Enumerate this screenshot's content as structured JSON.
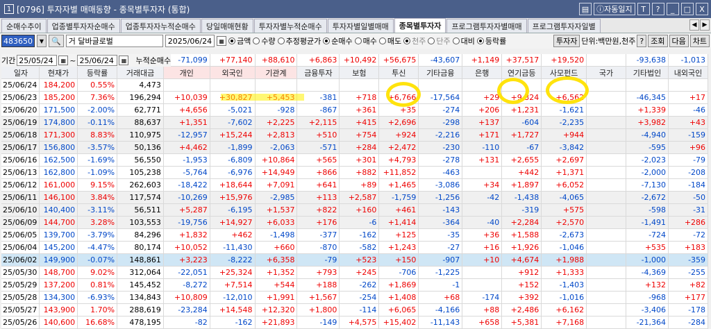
{
  "window": {
    "number": "1",
    "title": "[0796] 투자자별 매매동향 - 종목별투자자 (통합)",
    "auto_label": "자동일지",
    "buttons": [
      "T",
      "?",
      "_",
      "□",
      "X"
    ]
  },
  "tabs": [
    "순매수추이",
    "업종별투자자순매수",
    "업종투자자누적순매수",
    "당일매매현황",
    "투자자별누적순매수",
    "투자자별일별매매",
    "종목별투자자",
    "프로그램투자자별매매",
    "프로그램투자자일별"
  ],
  "active_tab": "종목별투자자",
  "controls": {
    "code": "483650",
    "stock_type": "거",
    "stock_name": "달바글로벌",
    "date": "2025/06/24",
    "radio_amount": [
      "금액",
      "수량",
      "추정평균가"
    ],
    "radio_trade": [
      "순매수",
      "매수",
      "매도"
    ],
    "radio_unit": [
      "천주",
      "단주"
    ],
    "radio_compare": [
      "대비",
      "등락률"
    ],
    "investor_btn": "투자자",
    "unit_label": "단위:백만원,천주",
    "help": "?",
    "search": "조회",
    "next": "다음",
    "chart": "차트"
  },
  "period": {
    "label": "기간",
    "from": "25/05/24",
    "to": "25/06/24",
    "cumulative_label": "누적순매수"
  },
  "summary": [
    "",
    "",
    "",
    "",
    "-71,099",
    "+77,140",
    "+88,610",
    "+6,863",
    "+10,492",
    "+56,675",
    "-43,607",
    "+1,149",
    "+37,517",
    "+19,520",
    "",
    "-93,638",
    "-1,013"
  ],
  "summary_colors": [
    "",
    "",
    "",
    "",
    "b",
    "r",
    "r",
    "r",
    "r",
    "r",
    "b",
    "r",
    "r",
    "r",
    "",
    "b",
    "b"
  ],
  "columns": [
    "일자",
    "현재가",
    "등락률",
    "거래대금",
    "개인",
    "외국인",
    "기관계",
    "금융투자",
    "보험",
    "투신",
    "기타금융",
    "은행",
    "연기금등",
    "사모펀드",
    "국가",
    "기타법인",
    "내외국인"
  ],
  "rows": [
    [
      "25/06/24",
      "184,200",
      "0.55%",
      "4,473",
      "",
      "",
      "",
      "",
      "",
      "",
      "",
      "",
      "",
      "",
      "",
      "",
      ""
    ],
    [
      "25/06/23",
      "185,200",
      "7.36%",
      "196,294",
      "+10,039",
      "+30,827",
      "+5,453",
      "-381",
      "+718",
      "+6,766",
      "-17,564",
      "+29",
      "+9,324",
      "+6,562",
      "",
      "-46,345",
      "+17"
    ],
    [
      "25/06/20",
      "171,500",
      "-2.00%",
      "62,771",
      "+4,656",
      "-5,021",
      "-928",
      "-867",
      "+361",
      "+35",
      "-274",
      "+206",
      "+1,231",
      "-1,621",
      "",
      "+1,339",
      "-46"
    ],
    [
      "25/06/19",
      "174,800",
      "-0.11%",
      "88,637",
      "+1,351",
      "-7,602",
      "+2,225",
      "+2,115",
      "+415",
      "+2,696",
      "-298",
      "+137",
      "-604",
      "-2,235",
      "",
      "+3,982",
      "+43"
    ],
    [
      "25/06/18",
      "171,300",
      "8.83%",
      "110,975",
      "-12,957",
      "+15,244",
      "+2,813",
      "+510",
      "+754",
      "+924",
      "-2,216",
      "+171",
      "+1,727",
      "+944",
      "",
      "-4,940",
      "-159"
    ],
    [
      "25/06/17",
      "156,800",
      "-3.57%",
      "50,136",
      "+4,462",
      "-1,899",
      "-2,063",
      "-571",
      "+284",
      "+2,472",
      "-230",
      "-110",
      "-67",
      "-3,842",
      "",
      "-595",
      "+96"
    ],
    [
      "25/06/16",
      "162,500",
      "-1.69%",
      "56,550",
      "-1,953",
      "-6,809",
      "+10,864",
      "+565",
      "+301",
      "+4,793",
      "-278",
      "+131",
      "+2,655",
      "+2,697",
      "",
      "-2,023",
      "-79"
    ],
    [
      "25/06/13",
      "162,800",
      "-1.09%",
      "105,238",
      "-5,764",
      "-6,976",
      "+14,949",
      "+866",
      "+882",
      "+11,852",
      "-463",
      "",
      "+442",
      "+1,371",
      "",
      "-2,000",
      "-208"
    ],
    [
      "25/06/12",
      "161,000",
      "9.15%",
      "262,603",
      "-18,422",
      "+18,644",
      "+7,091",
      "+641",
      "+89",
      "+1,465",
      "-3,086",
      "+34",
      "+1,897",
      "+6,052",
      "",
      "-7,130",
      "-184"
    ],
    [
      "25/06/11",
      "146,100",
      "3.84%",
      "117,574",
      "-10,269",
      "+15,976",
      "-2,985",
      "+113",
      "+2,587",
      "-1,759",
      "-1,256",
      "-42",
      "-1,438",
      "-4,065",
      "",
      "-2,672",
      "-50"
    ],
    [
      "25/06/10",
      "140,400",
      "-3.11%",
      "56,511",
      "+5,287",
      "-6,195",
      "+1,537",
      "+822",
      "+160",
      "+461",
      "-143",
      "",
      "-319",
      "+575",
      "",
      "-598",
      "-31"
    ],
    [
      "25/06/09",
      "144,700",
      "3.28%",
      "103,553",
      "-19,756",
      "+14,927",
      "+6,033",
      "+176",
      "-6",
      "+1,414",
      "-364",
      "-40",
      "+2,284",
      "+2,570",
      "",
      "-1,491",
      "+286"
    ],
    [
      "25/06/05",
      "139,700",
      "-3.79%",
      "84,296",
      "+1,832",
      "+462",
      "-1,498",
      "-377",
      "-162",
      "+125",
      "-35",
      "+36",
      "+1,588",
      "-2,673",
      "",
      "-724",
      "-72"
    ],
    [
      "25/06/04",
      "145,200",
      "-4.47%",
      "80,174",
      "+10,052",
      "-11,430",
      "+660",
      "-870",
      "-582",
      "+1,243",
      "-27",
      "+16",
      "+1,926",
      "-1,046",
      "",
      "+535",
      "+183"
    ],
    [
      "25/06/02",
      "149,900",
      "-0.07%",
      "148,861",
      "+3,223",
      "-8,222",
      "+6,358",
      "-79",
      "+523",
      "+150",
      "-907",
      "+10",
      "+4,674",
      "+1,988",
      "",
      "-1,000",
      "-359"
    ],
    [
      "25/05/30",
      "148,700",
      "9.02%",
      "312,064",
      "-22,051",
      "+25,324",
      "+1,352",
      "+793",
      "+245",
      "-706",
      "-1,225",
      "",
      "+912",
      "+1,333",
      "",
      "-4,369",
      "-255"
    ],
    [
      "25/05/29",
      "137,200",
      "0.81%",
      "145,452",
      "-8,272",
      "+7,514",
      "+544",
      "+188",
      "-262",
      "+1,869",
      "-1",
      "",
      "+152",
      "-1,403",
      "",
      "+132",
      "+82"
    ],
    [
      "25/05/28",
      "134,300",
      "-6.93%",
      "134,843",
      "+10,809",
      "-12,010",
      "+1,991",
      "+1,567",
      "-254",
      "+1,408",
      "+68",
      "-174",
      "+392",
      "-1,016",
      "",
      "-968",
      "+177"
    ],
    [
      "25/05/27",
      "143,900",
      "1.70%",
      "288,619",
      "-23,284",
      "+14,548",
      "+12,320",
      "+1,800",
      "-114",
      "+6,065",
      "-4,166",
      "+88",
      "+2,486",
      "+6,162",
      "",
      "-3,406",
      "-178"
    ],
    [
      "25/05/26",
      "140,600",
      "16.68%",
      "478,195",
      "-82",
      "-162",
      "+21,893",
      "-149",
      "+4,575",
      "+15,402",
      "-11,143",
      "+658",
      "+5,381",
      "+7,168",
      "",
      "-21,364",
      "-284"
    ]
  ]
}
